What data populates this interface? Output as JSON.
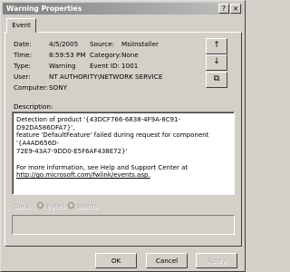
{
  "window": {
    "title": "Warning Properties",
    "help_glyph": "?",
    "close_glyph": "×"
  },
  "tabs": [
    {
      "label": "Event"
    }
  ],
  "event": {
    "date_label": "Date:",
    "date": "4/5/2005",
    "source_label": "Source:",
    "source": "MsiInstaller",
    "time_label": "Time:",
    "time": "8:59:53 PM",
    "category_label": "Category:",
    "category": "None",
    "type_label": "Type:",
    "type": "Warning",
    "event_id_label": "Event ID:",
    "event_id": "1001",
    "user_label": "User:",
    "user": "NT AUTHORITY\\NETWORK SERVICE",
    "computer_label": "Computer:",
    "computer": "SONY"
  },
  "nav": {
    "up_glyph": "↑",
    "down_glyph": "↓",
    "copy_glyph": "⧉"
  },
  "description": {
    "label": "Description:",
    "line1": "Detection of product '{43DCF766-6838-4F9A-8C91-D92DA586DFA7}',",
    "line2": "feature 'DefaultFeature' failed during request for component '{A4AD656D-",
    "line3": "72E9-43A7-9DD0-E5F6AF438E72}'",
    "help_text": "For more information, see Help and Support Center at",
    "help_link": "http://go.microsoft.com/fwlink/events.asp."
  },
  "data_section": {
    "label": "Data:",
    "bytes_label": "Bytes",
    "words_label": "Words"
  },
  "buttons": {
    "ok": "OK",
    "cancel": "Cancel",
    "apply": "Apply"
  }
}
